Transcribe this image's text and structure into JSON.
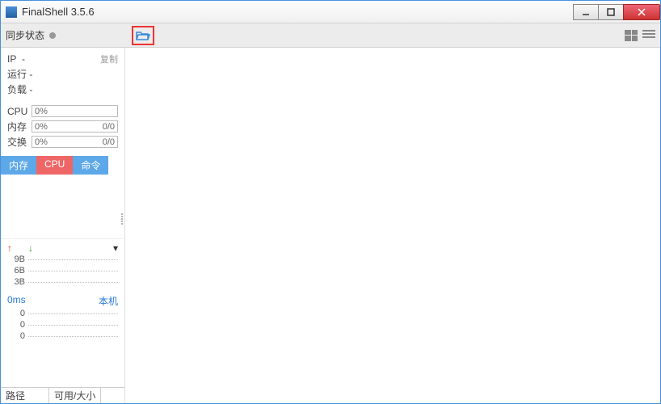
{
  "window": {
    "title": "FinalShell 3.5.6"
  },
  "toolbar": {
    "sync_label": "同步状态",
    "view_grid": "grid-view",
    "view_list": "list-view"
  },
  "info": {
    "ip_label": "IP",
    "ip_value": "-",
    "copy_label": "复制",
    "run_label": "运行",
    "run_value": "-",
    "load_label": "负载",
    "load_value": "-"
  },
  "metrics": {
    "cpu": {
      "label": "CPU",
      "value": "0%"
    },
    "mem": {
      "label": "内存",
      "value": "0%",
      "ratio": "0/0"
    },
    "swap": {
      "label": "交换",
      "value": "0%",
      "ratio": "0/0"
    }
  },
  "tabs": {
    "mem": "内存",
    "cpu": "CPU",
    "cmd": "命令"
  },
  "net": {
    "scale": [
      "9B",
      "6B",
      "3B"
    ]
  },
  "ping": {
    "ms_label": "0ms",
    "host_label": "本机",
    "values": [
      "0",
      "0",
      "0"
    ]
  },
  "fs": {
    "path_label": "路径",
    "size_label": "可用/大小"
  }
}
